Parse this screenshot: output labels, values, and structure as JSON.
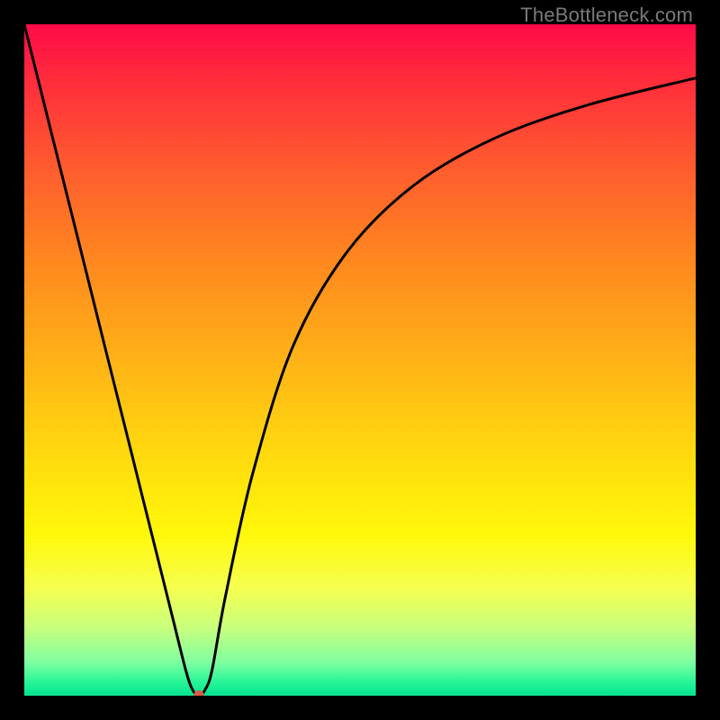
{
  "watermark": "TheBottleneck.com",
  "chart_data": {
    "type": "line",
    "title": "",
    "xlabel": "",
    "ylabel": "",
    "xlim": [
      0,
      100
    ],
    "ylim": [
      0,
      100
    ],
    "grid": false,
    "legend": false,
    "background": "red-to-green vertical gradient",
    "series": [
      {
        "name": "bottleneck-curve",
        "color": "#000000",
        "x": [
          0,
          4,
          8,
          12,
          16,
          20,
          22,
          24,
          25,
          26,
          27,
          28,
          30,
          34,
          40,
          48,
          58,
          70,
          84,
          100
        ],
        "y": [
          100,
          84,
          68,
          52,
          36,
          20,
          12,
          4,
          1,
          0,
          1,
          4,
          15,
          33,
          52,
          66,
          76,
          83,
          88,
          92
        ]
      }
    ],
    "marker": {
      "name": "optimal-point",
      "x": 26,
      "y": 0,
      "color": "#d95a4a",
      "radius_px": 6
    }
  }
}
